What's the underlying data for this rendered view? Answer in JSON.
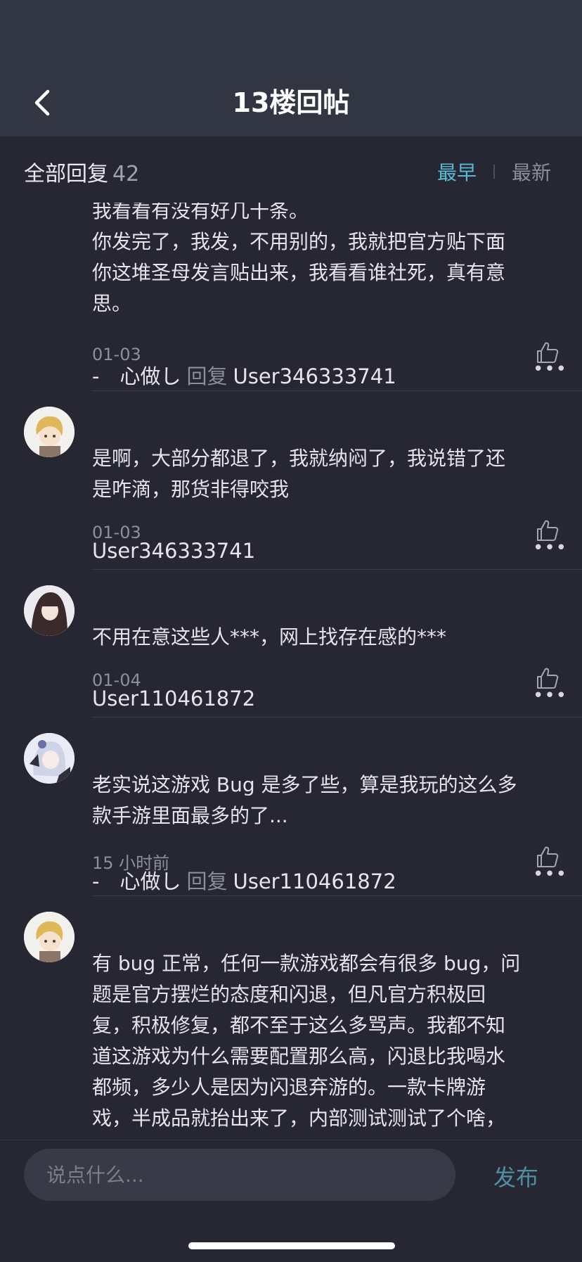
{
  "header": {
    "title": "13楼回帖",
    "back_icon": "chevron-left-icon"
  },
  "replies_header": {
    "label": "全部回复",
    "count": "42",
    "sort_earliest": "最早",
    "sort_latest": "最新",
    "active_color": "#5ab9d3"
  },
  "comments": [
    {
      "text_lines": [
        "我看看有没有好几十条。",
        "你发完了，我发，不用别的，我就把官方贴下面",
        "你这堆圣母发言贴出来，我看看谁社死，真有意",
        "思。"
      ],
      "date": "01-03"
    },
    {
      "author": "-　心做し",
      "reply_word": "回复",
      "reply_to": "User346333741",
      "text_lines": [
        "是啊，大部分都退了，我就纳闷了，我说错了还",
        "是咋滴，那货非得咬我"
      ],
      "date": "01-03",
      "more": "•••"
    },
    {
      "author": "User346333741",
      "text_lines": [
        "不用在意这些人***，网上找存在感的***"
      ],
      "date": "01-04",
      "more": "•••"
    },
    {
      "author": "User110461872",
      "text_lines": [
        "老实说这游戏 Bug 是多了些，算是我玩的这么多",
        "款手游里面最多的了..."
      ],
      "date": "15 小时前",
      "more": "•••"
    },
    {
      "author": "-　心做し",
      "reply_word": "回复",
      "reply_to": "User110461872",
      "text_lines": [
        "有 bug 正常，任何一款游戏都会有很多 bug，问",
        "题是官方摆烂的态度和闪退，但凡官方积极回",
        "复，积极修复，都不至于这么多骂声。我都不知",
        "道这游戏为什么需要配置那么高，闪退比我喝水",
        "都频，多少人是因为闪退弃游的。一款卡牌游",
        "戏，半成品就抬出来了，内部测试测试了个啥，"
      ],
      "more": "•••"
    }
  ],
  "composer": {
    "placeholder": "说点什么...",
    "publish_label": "发布"
  }
}
